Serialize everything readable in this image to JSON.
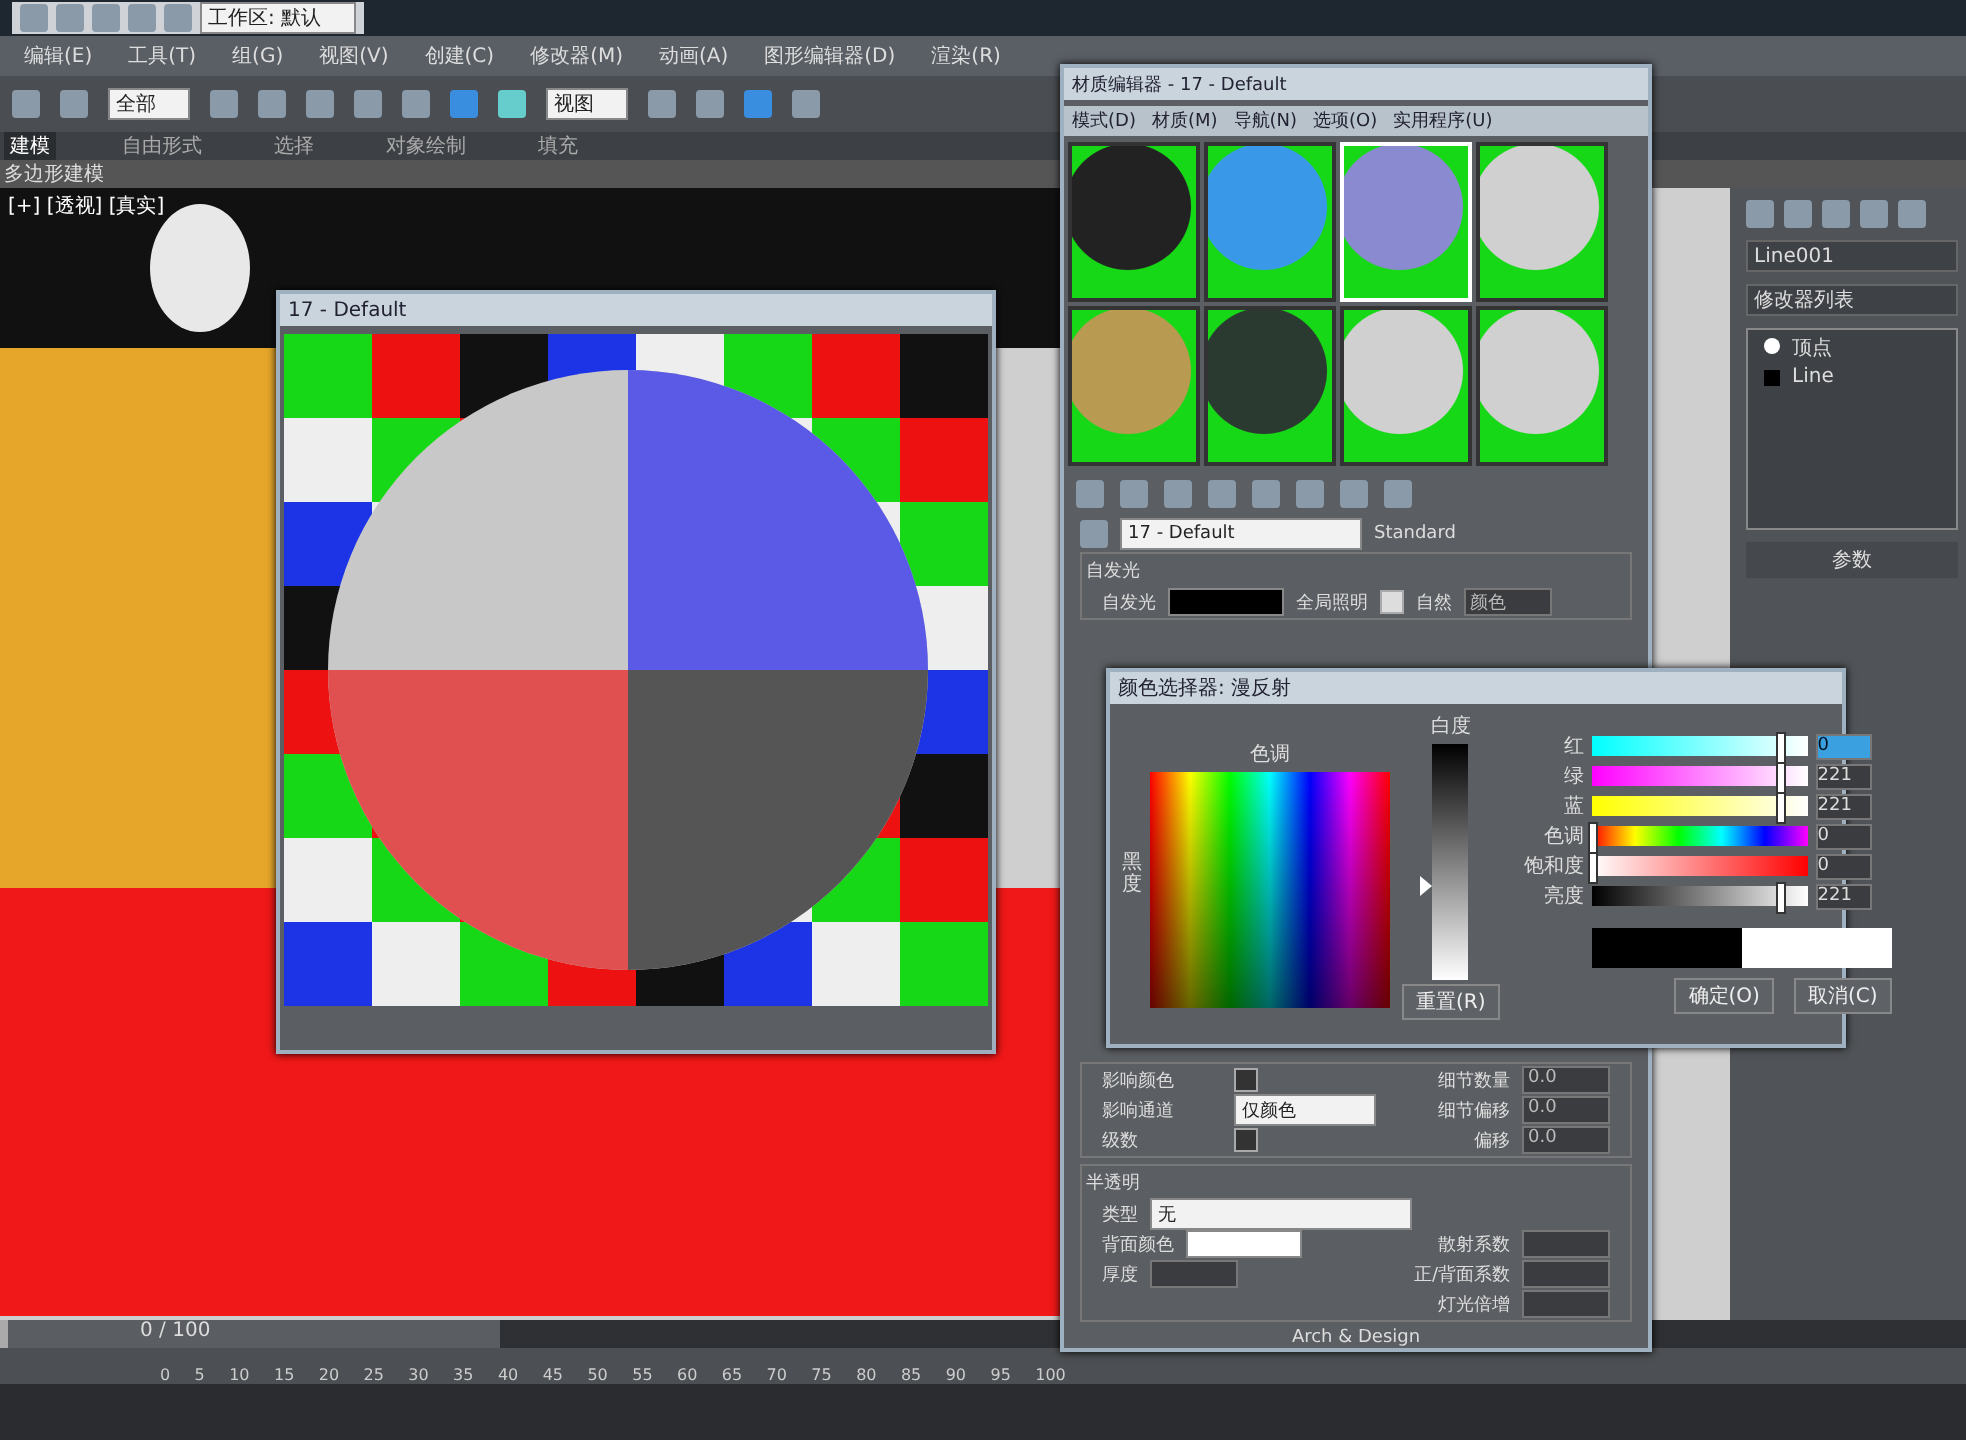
{
  "title_bar": {
    "workspace": "工作区: 默认"
  },
  "menus": [
    "编辑(E)",
    "工具(T)",
    "组(G)",
    "视图(V)",
    "创建(C)",
    "修改器(M)",
    "动画(A)",
    "图形编辑器(D)",
    "渲染(R)"
  ],
  "toolbar": {
    "selection_filter": "全部",
    "reference_coord": "视图"
  },
  "ribbon_tabs": [
    {
      "label": "建模",
      "selected": true
    },
    {
      "label": "自由形式",
      "selected": false
    },
    {
      "label": "选择",
      "selected": false
    },
    {
      "label": "对象绘制",
      "selected": false
    },
    {
      "label": "填充",
      "selected": false
    }
  ],
  "ribbon_panel": "多边形建模",
  "viewport": {
    "label": "[+] [透视] [真实]"
  },
  "preview_window": {
    "title": "17 - Default"
  },
  "material_editor": {
    "title": "材质编辑器 - 17 - Default",
    "menus": [
      "模式(D)",
      "材质(M)",
      "导航(N)",
      "选项(O)",
      "实用程序(U)"
    ],
    "slots": [
      {
        "kind": "dark",
        "selected": false
      },
      {
        "kind": "blue",
        "selected": false
      },
      {
        "kind": "checker",
        "selected": true
      },
      {
        "kind": "gray",
        "selected": false
      },
      {
        "kind": "gold",
        "selected": false
      },
      {
        "kind": "glass",
        "selected": false
      },
      {
        "kind": "gray",
        "selected": false
      },
      {
        "kind": "gray",
        "selected": false
      }
    ],
    "material_name": "17 - Default",
    "material_type": "Standard",
    "self_illum": {
      "group": "自发光",
      "label": "自发光",
      "global_label": "全局照明",
      "checkbox_label": "自然",
      "checked": true,
      "value": "颜色"
    },
    "rows": [
      {
        "label": "影响颜色",
        "checked": false,
        "right_label": "细节数量",
        "right_value": "0.0"
      },
      {
        "label": "影响通道",
        "value": "仅颜色",
        "right_label": "细节偏移",
        "right_value": "0.0"
      },
      {
        "label": "级数",
        "checked": false,
        "right_label": "偏移",
        "right_value": "0.0"
      }
    ],
    "translucency": {
      "group": "半透明",
      "type_label": "类型",
      "type_value": "无",
      "back_label": "背面颜色",
      "thick_label": "厚度",
      "rows": [
        "散射系数",
        "正/背面系数",
        "灯光倍增"
      ]
    },
    "footer": "Arch & Design"
  },
  "color_picker": {
    "title": "颜色选择器: 漫反射",
    "hue_label": "色调",
    "whiteness": {
      "label": "白度",
      "level": 0.6
    },
    "blackness_label": "黑度",
    "channels": [
      {
        "label": "红",
        "kind": "red",
        "value": "0",
        "selected": true,
        "level": 0.87
      },
      {
        "label": "绿",
        "kind": "green",
        "value": "221",
        "selected": false,
        "level": 0.87
      },
      {
        "label": "蓝",
        "kind": "blue",
        "value": "221",
        "selected": false,
        "level": 0.87
      },
      {
        "label": "色调",
        "kind": "hue",
        "value": "0",
        "selected": false,
        "level": 0
      },
      {
        "label": "饱和度",
        "kind": "sat",
        "value": "0",
        "selected": false,
        "level": 0
      },
      {
        "label": "亮度",
        "kind": "val",
        "value": "221",
        "selected": false,
        "level": 0.87
      }
    ],
    "swatches": [
      {
        "color": "#000000"
      },
      {
        "color": "#ffffff"
      }
    ],
    "reset": "重置(R)",
    "ok": "确定(O)",
    "cancel": "取消(C)"
  },
  "command_panel": {
    "object_name": "Line001",
    "modifier_list": "修改器列表",
    "stack": [
      {
        "label": "顶点",
        "kind": "sub"
      },
      {
        "label": "Line",
        "kind": "base"
      }
    ],
    "rollout": "参数"
  },
  "timeline": {
    "slider": {
      "label": "0 / 100",
      "level": 0
    },
    "ticks": [
      "0",
      "5",
      "10",
      "15",
      "20",
      "25",
      "30",
      "35",
      "40",
      "45",
      "50",
      "55",
      "60",
      "65",
      "70",
      "75",
      "80",
      "85",
      "90",
      "95",
      "100"
    ]
  }
}
